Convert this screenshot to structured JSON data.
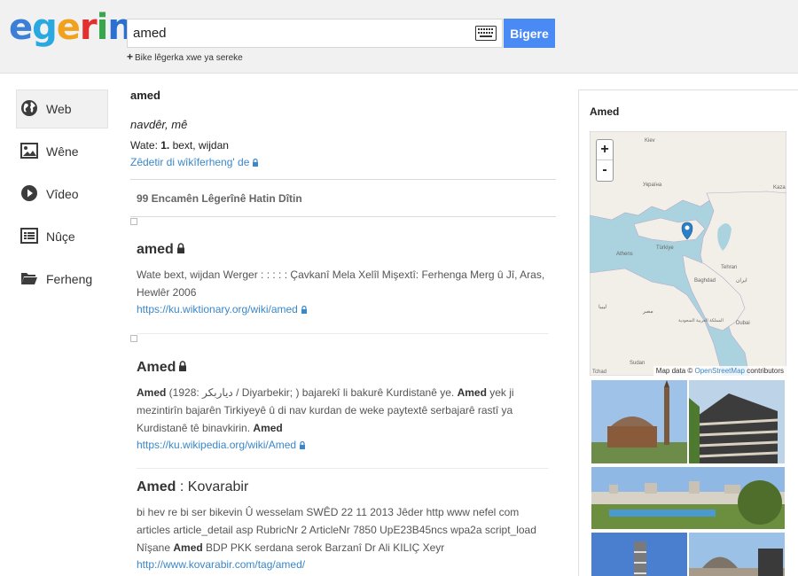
{
  "header": {
    "logo": "egerin",
    "search_value": "amed",
    "search_button": "Bigere",
    "add_word": "Bike lêgerka xwe ya sereke"
  },
  "nav": {
    "items": [
      {
        "label": "Web",
        "icon": "globe-icon",
        "active": true
      },
      {
        "label": "Wêne",
        "icon": "image-icon",
        "active": false
      },
      {
        "label": "Vîdeo",
        "icon": "play-icon",
        "active": false
      },
      {
        "label": "Nûçe",
        "icon": "news-icon",
        "active": false
      },
      {
        "label": "Ferheng",
        "icon": "folder-icon",
        "active": false
      }
    ]
  },
  "dictionary": {
    "word": "amed",
    "pos": "navdêr, mê",
    "meaning_prefix": "Wate: ",
    "meaning_num": "1.",
    "meaning_text": " bext, wijdan",
    "edit_link": "Zêdetir di wîkîferheng' de"
  },
  "results": {
    "count_label": "99 Encamên Lêgerînê Hatin Dîtin",
    "items": [
      {
        "title": "amed",
        "snippet": "Wate bext, wijdan Werger : : : : : Çavkanî Mela Xelîl Mişextî: Ferhenga Merg û Jî, Aras, Hewlêr 2006",
        "url": "https://ku.wiktionary.org/wiki/amed"
      },
      {
        "title": "Amed",
        "snippet_bold_1": "Amed",
        "snippet_1": " (1928: دیاربکر / Diyarbekir; ) bajarekî li bakurê Kurdistanê ye. ",
        "snippet_bold_2": "Amed",
        "snippet_2": " yek ji mezintirîn bajarên Tirkiyeyê û di nav kurdan de weke paytextê serbajarê rastî ya Kurdistanê tê binavkirin. ",
        "snippet_bold_3": "Amed",
        "url": "https://ku.wikipedia.org/wiki/Amed"
      },
      {
        "title": "Amed",
        "title_suffix": " : Kovarabir",
        "snippet_1": "bi hev re bi ser bikevin Û wesselam SWÊD 22 11 2013 Jêder http www nefel com articles article_detail asp RubricNr 2 ArticleNr 7850 UpE23B45ncs wpa2a script_load Nîşane ",
        "snippet_bold": "Amed",
        "snippet_2": " BDP PKK serdana serok Barzanî Dr Ali KILIÇ Xeyr",
        "url": "http://www.kovarabir.com/tag/amed/"
      }
    ]
  },
  "panel": {
    "title": "Amed",
    "map_labels": [
      "Kiev",
      "Україна",
      "Türkiye",
      "Athens",
      "Tehran",
      "Baghdad",
      "ایران",
      "مصر",
      "المملكة العربية السعودية",
      "ليبيا",
      "Dubai",
      "Sudan",
      "Tchad",
      "Kaza"
    ],
    "attribution_prefix": "Map data © ",
    "attribution_link": "OpenStreetMap",
    "attribution_suffix": " contributors",
    "zoom_in": "+",
    "zoom_out": "-"
  },
  "colors": {
    "accent": "#4a8af4",
    "link": "#3a87c9",
    "marker": "#2a7fc6"
  }
}
